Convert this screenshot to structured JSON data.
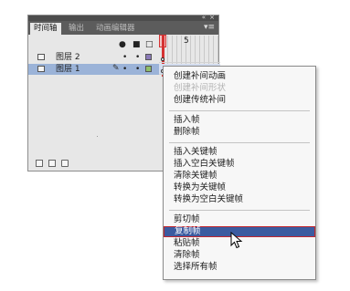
{
  "panel": {
    "tabs": [
      {
        "label": "时间轴",
        "active": true
      },
      {
        "label": "输出",
        "active": false
      },
      {
        "label": "动画编辑器",
        "active": false
      }
    ],
    "header_icons": [
      "eye-icon",
      "lock-icon",
      "outline-icon"
    ],
    "frame_label": "5",
    "layers": [
      {
        "name": "图层 2",
        "selected": false,
        "color": "#8b7ab8"
      },
      {
        "name": "图层 1",
        "selected": true,
        "color": "#8fbf6a"
      }
    ]
  },
  "menu": {
    "groups": [
      [
        {
          "label": "创建补间动画",
          "disabled": false
        },
        {
          "label": "创建补间形状",
          "disabled": true
        },
        {
          "label": "创建传统补间",
          "disabled": false
        }
      ],
      [
        {
          "label": "插入帧",
          "disabled": false
        },
        {
          "label": "删除帧",
          "disabled": false
        }
      ],
      [
        {
          "label": "插入关键帧",
          "disabled": false
        },
        {
          "label": "插入空白关键帧",
          "disabled": false
        },
        {
          "label": "清除关键帧",
          "disabled": false
        },
        {
          "label": "转换为关键帧",
          "disabled": false
        },
        {
          "label": "转换为空白关键帧",
          "disabled": false
        }
      ],
      [
        {
          "label": "剪切帧",
          "disabled": false
        },
        {
          "label": "复制帧",
          "disabled": false,
          "highlighted": true
        },
        {
          "label": "粘贴帧",
          "disabled": false
        },
        {
          "label": "清除帧",
          "disabled": false
        },
        {
          "label": "选择所有帧",
          "disabled": false
        }
      ]
    ]
  },
  "colors": {
    "highlight": "#3b5ba0",
    "playhead": "#d53232",
    "layer_selected": "#9bb3d8"
  }
}
